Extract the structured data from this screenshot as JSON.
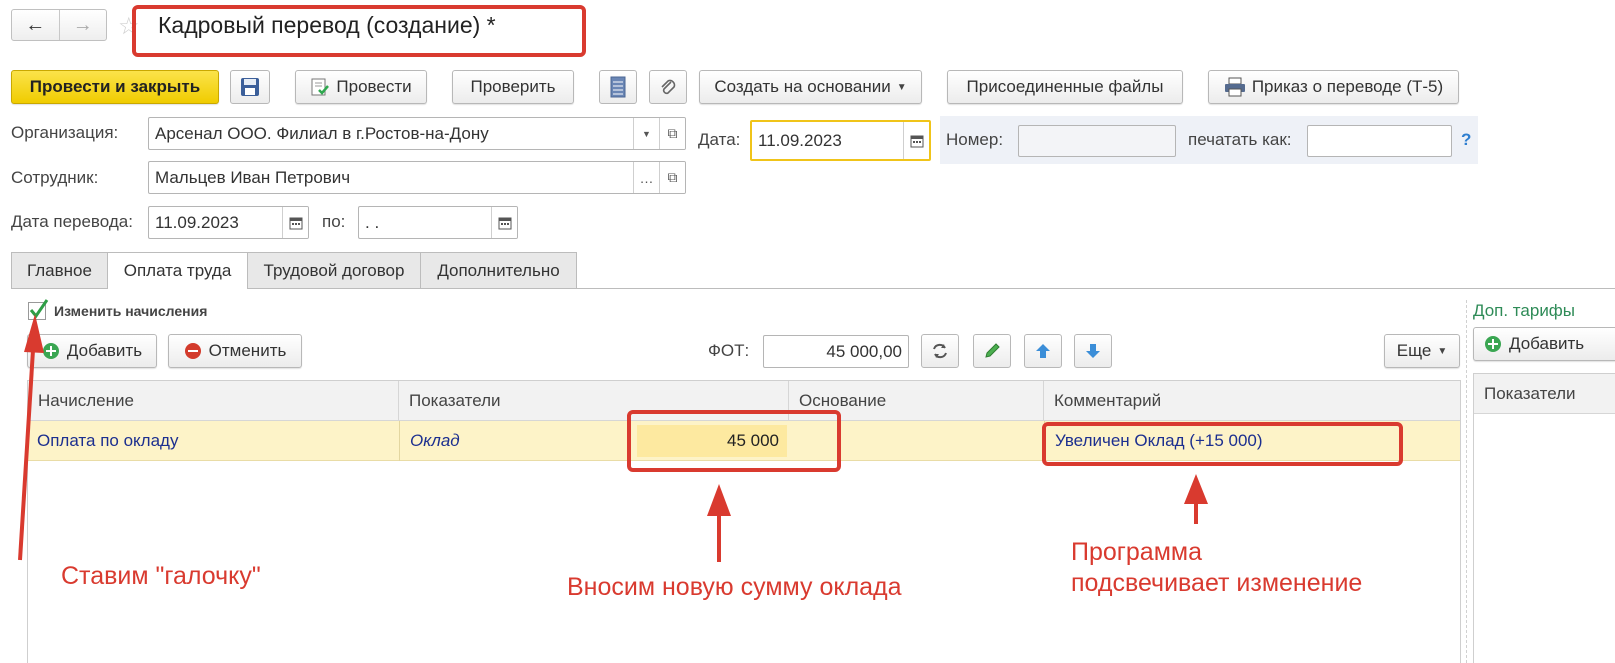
{
  "window": {
    "title": "Кадровый перевод (создание) *"
  },
  "nav": {
    "back_label": "←",
    "forward_label": "→",
    "favorite_label": "☆"
  },
  "toolbar": {
    "post_close": "Провести и закрыть",
    "save_icon": "floppy-disk-icon",
    "post": "Провести",
    "check": "Проверить",
    "create_based": "Создать на основании",
    "attached_files": "Присоединенные файлы",
    "print_order": "Приказ о переводе (Т-5)"
  },
  "form": {
    "org_label": "Организация:",
    "org_value": "Арсенал ООО. Филиал в г.Ростов-на-Дону",
    "employee_label": "Сотрудник:",
    "employee_value": "Мальцев Иван Петрович",
    "transfer_date_label": "Дата перевода:",
    "transfer_date_value": "11.09.2023",
    "to_label": "по:",
    "to_value": " .  .",
    "date_label": "Дата:",
    "date_value": "11.09.2023",
    "number_label": "Номер:",
    "number_value": "",
    "print_as_label": "печатать как:",
    "print_as_value": "",
    "help": "?"
  },
  "tabs": [
    {
      "label": "Главное"
    },
    {
      "label": "Оплата труда"
    },
    {
      "label": "Трудовой договор"
    },
    {
      "label": "Дополнительно"
    }
  ],
  "payroll": {
    "change_accruals_label": "Изменить начисления",
    "change_accruals_checked": true,
    "add": "Добавить",
    "cancel": "Отменить",
    "fot_label": "ФОТ:",
    "fot_value": "45 000,00",
    "more": "Еще",
    "columns": [
      "Начисление",
      "Показатели",
      "Основание",
      "Комментарий"
    ],
    "row": {
      "accrual": "Оплата по окладу",
      "indicator": "Оклад",
      "amount": "45 000",
      "basis": "",
      "comment": "Увеличен Оклад (+15 000)"
    }
  },
  "right_panel": {
    "title": "Доп. тарифы",
    "add": "Добавить",
    "column": "Показатели"
  },
  "annotations": {
    "check_hint": "Ставим  \"галочку\"",
    "amount_hint": "Вносим новую сумму оклада",
    "highlight_hint_1": "Программа",
    "highlight_hint_2": "подсвечивает изменение"
  },
  "colors": {
    "accent_yellow": "#f5d400",
    "row_highlight": "#fdf3c8",
    "changed_cell": "#fde9a0",
    "annotation_red": "#d93a2f",
    "link_blue": "#1c2f8f",
    "green_title": "#2e8b57"
  }
}
